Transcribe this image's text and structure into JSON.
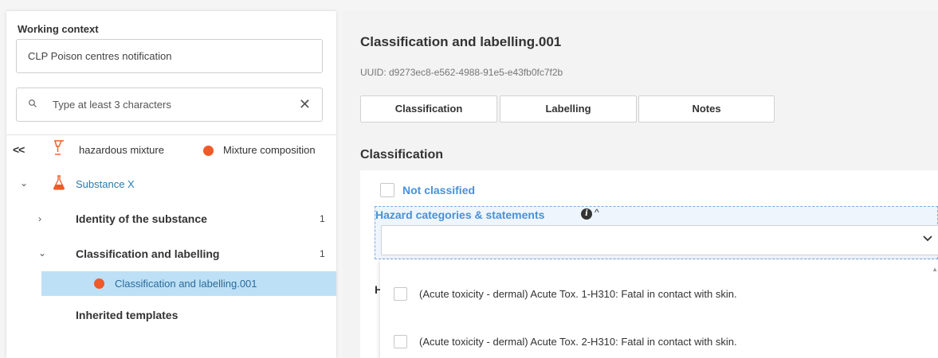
{
  "left": {
    "working_context_label": "Working context",
    "working_context_value": "CLP Poison centres notification",
    "search_placeholder": "Type at least 3 characters",
    "breadcrumb": {
      "back_label": "<<",
      "item1": "hazardous mixture",
      "item2": "Mixture composition"
    },
    "tree": {
      "substance": "Substance X",
      "identity": "Identity of the substance",
      "identity_count": "1",
      "cl": "Classification and labelling",
      "cl_count": "1",
      "cl_selected": "Classification and labelling.001",
      "inherited": "Inherited templates"
    }
  },
  "right": {
    "title": "Classification and labelling.001",
    "uuid": "UUID: d9273ec8-e562-4988-91e5-e43fb0fc7f2b",
    "tabs": [
      "Classification",
      "Labelling",
      "Notes"
    ],
    "section_title": "Classification",
    "not_classified_label": "Not classified",
    "hazard_label": "Hazard categories & statements",
    "hidden_letter": "H",
    "options": [
      "(Acute toxicity - dermal) Acute Tox. 1-H310: Fatal in contact with skin.",
      "(Acute toxicity - dermal) Acute Tox. 2-H310: Fatal in contact with skin."
    ]
  },
  "colors": {
    "accent_blue": "#4a90d9",
    "selected_row": "#bde0f7",
    "orange": "#f05a28"
  }
}
